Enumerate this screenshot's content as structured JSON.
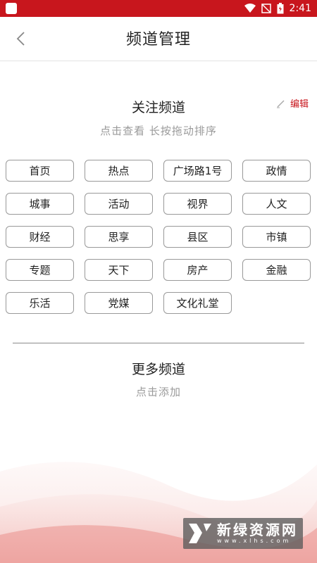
{
  "status_bar": {
    "time": "2:41"
  },
  "header": {
    "title": "频道管理"
  },
  "followed": {
    "title": "关注频道",
    "hint": "点击查看  长按拖动排序",
    "edit_label": "编辑",
    "channels": [
      "首页",
      "热点",
      "广场路1号",
      "政情",
      "城事",
      "活动",
      "视界",
      "人文",
      "财经",
      "思享",
      "县区",
      "市镇",
      "专题",
      "天下",
      "房产",
      "金融",
      "乐活",
      "党媒",
      "文化礼堂"
    ]
  },
  "more": {
    "title": "更多频道",
    "hint": "点击添加"
  },
  "watermark": {
    "text": "新绿资源网",
    "sub": "www.xlhs.com"
  },
  "colors": {
    "accent": "#c8161d",
    "chip_border": "#999999",
    "hint": "#9a9a9a"
  }
}
